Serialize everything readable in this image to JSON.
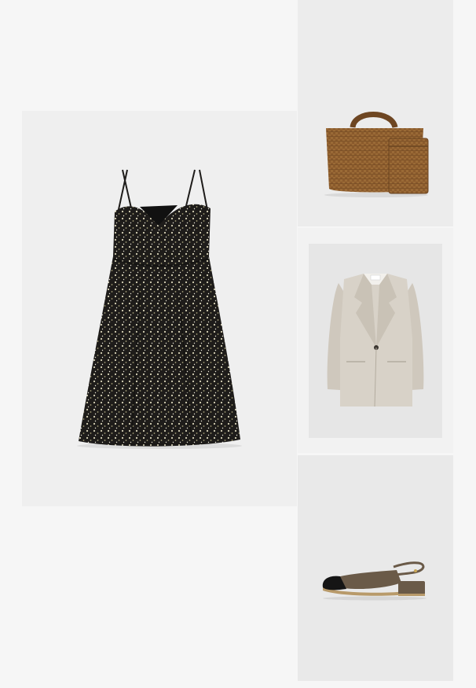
{
  "board": {
    "items": [
      {
        "name": "floral-slip-dress",
        "icon": "dress-image"
      },
      {
        "name": "woven-tote-bag",
        "icon": "bag-image"
      },
      {
        "name": "linen-blazer",
        "icon": "blazer-image"
      },
      {
        "name": "slingback-flat",
        "icon": "shoe-image"
      }
    ]
  },
  "colors": {
    "page_background": "#f6f6f6",
    "dress_tile": "#efefef",
    "bag_tile": "#ececec",
    "blazer_tile": "#e6e6e6",
    "shoe_tile": "#e9e9e9",
    "dress": "#1e1c1a",
    "bag": "#8a5a2c",
    "blazer": "#d8d2c8",
    "shoe_upper": "#6a5a48",
    "shoe_toe": "#151515"
  }
}
